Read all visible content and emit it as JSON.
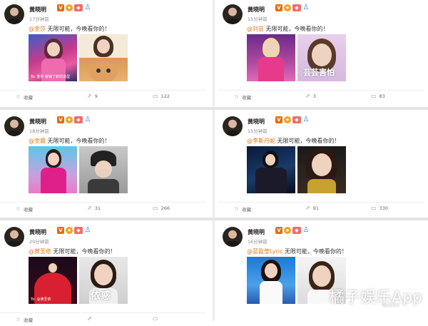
{
  "colors": {
    "mention": "#e07a1a",
    "separator": "#e4e4e4"
  },
  "posts": [
    {
      "user": "黄晓明",
      "time": "17分钟前",
      "mention": "@金莎",
      "text": "无限可能，今晚看你的！",
      "image_caption_1": "To: 金莎 解锁了新的造型",
      "image_caption_2": "",
      "collect": "收藏",
      "repost": "9",
      "comment": "122"
    },
    {
      "user": "黄晓明",
      "time": "15分钟前",
      "mention": "@刘芸",
      "text": "无限可能，今晚看你的！",
      "image_caption_1": "",
      "image_caption_2": "芸芸害怕",
      "collect": "收藏",
      "repost": "3",
      "comment": "83"
    },
    {
      "user": "黄晓明",
      "time": "18分钟前",
      "mention": "@金晨",
      "text": "无限可能，今晚看你的！",
      "image_caption_1": "",
      "image_caption_2": "",
      "collect": "收藏",
      "repost": "31",
      "comment": "266"
    },
    {
      "user": "黄晓明",
      "time": "15分钟前",
      "mention": "@李斯丹妮",
      "text": "无限可能，今晚看你的！",
      "image_caption_1": "",
      "image_caption_2": "",
      "collect": "收藏",
      "repost": "91",
      "comment": "330"
    },
    {
      "user": "黄晓明",
      "time": "29分钟前",
      "mention": "@黄圣依",
      "text": "无限可能，今晚看你的！",
      "image_caption_1": "To: @黄圣依",
      "image_caption_2": "依惑",
      "collect": "收藏",
      "repost": "",
      "comment": ""
    },
    {
      "user": "黄晓明",
      "time": "16分钟前",
      "mention": "@蓝盈莹Lyric",
      "text": "无限可能，今晚看你的！",
      "image_caption_1": "",
      "image_caption_2": "",
      "collect": "",
      "repost": "",
      "comment": ""
    }
  ],
  "watermark": "橘子娱乐App",
  "watermark_sub": "@wsliii"
}
